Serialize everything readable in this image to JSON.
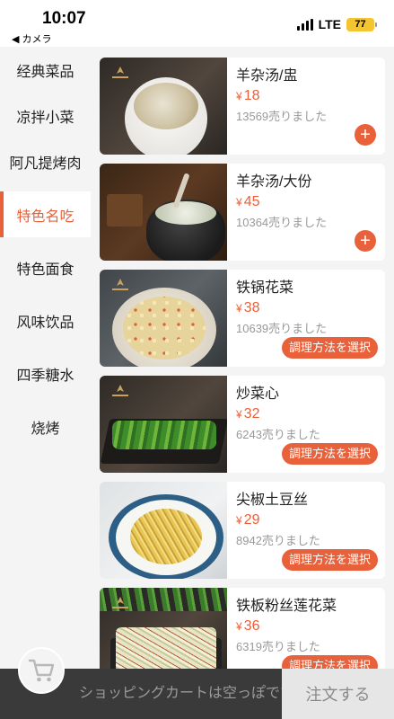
{
  "status_bar": {
    "time": "10:07",
    "back_label": "◀ カメラ",
    "network": "LTE",
    "battery": "77"
  },
  "sidebar": {
    "items": [
      {
        "label": "经典菜品"
      },
      {
        "label": "凉拌小菜"
      },
      {
        "label": "阿凡提烤肉"
      },
      {
        "label": "特色名吃",
        "active": true
      },
      {
        "label": "特色面食"
      },
      {
        "label": "风味饮品"
      },
      {
        "label": "四季糖水"
      },
      {
        "label": "烧烤"
      }
    ]
  },
  "products": [
    {
      "name": "羊杂汤/盅",
      "currency": "¥",
      "price": "18",
      "sold": "13569売りました",
      "action": "add",
      "icon": "plus-icon"
    },
    {
      "name": "羊杂汤/大份",
      "currency": "¥",
      "price": "45",
      "sold": "10364売りました",
      "action": "add",
      "icon": "plus-icon"
    },
    {
      "name": "铁锅花菜",
      "currency": "¥",
      "price": "38",
      "sold": "10639売りました",
      "action": "method",
      "action_label": "調理方法を選択"
    },
    {
      "name": "炒菜心",
      "currency": "¥",
      "price": "32",
      "sold": "6243売りました",
      "action": "method",
      "action_label": "調理方法を選択"
    },
    {
      "name": "尖椒土豆丝",
      "currency": "¥",
      "price": "29",
      "sold": "8942売りました",
      "action": "method",
      "action_label": "調理方法を選択"
    },
    {
      "name": "铁板粉丝莲花菜",
      "currency": "¥",
      "price": "36",
      "sold": "6319売りました",
      "action": "method",
      "action_label": "調理方法を選択"
    }
  ],
  "cart_bar": {
    "empty_text": "ショッピングカートは空っぽです",
    "order_label": "注文する",
    "cart_icon": "cart-icon"
  },
  "colors": {
    "accent": "#e8613a",
    "cart_bar": "#3a3a3a",
    "order_button": "#e6e6e6",
    "battery": "#f2c531"
  }
}
